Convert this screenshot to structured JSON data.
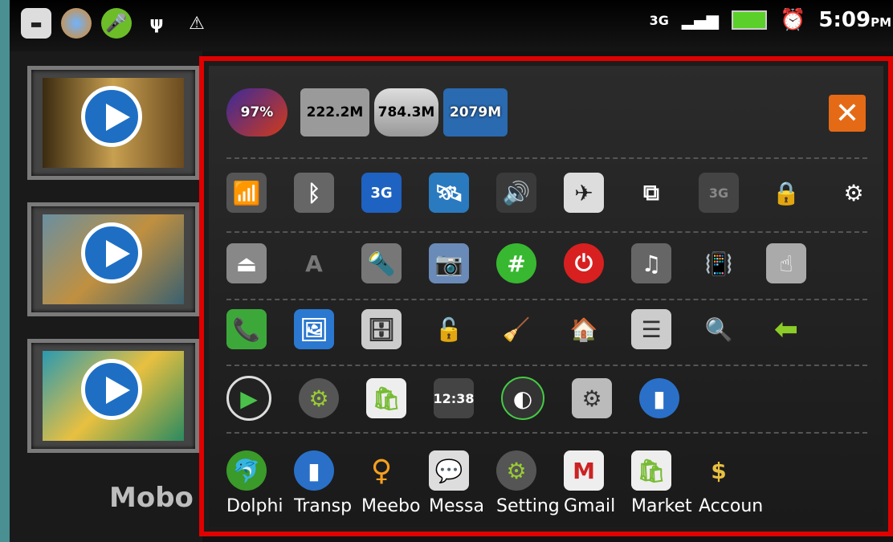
{
  "status_bar": {
    "icons_left": [
      "keyboard-icon",
      "browser-icon",
      "microphone-icon",
      "usb-icon",
      "warning-icon"
    ],
    "network": "3G",
    "time": "5:09",
    "ampm": "PM"
  },
  "left_pane": {
    "thumbnails": 3,
    "app_title": "Mobo"
  },
  "panel": {
    "info": {
      "battery": "97%",
      "memory": "222.2M",
      "storage": "784.3M",
      "sdcard": "2079M"
    },
    "labels": [
      "Dolphi",
      "Transp",
      "Meebo",
      "Messa",
      "Setting",
      "Gmail",
      "Market",
      "Accoun"
    ]
  },
  "colors": {
    "highlight_border": "#e10000",
    "close_button": "#e56a16"
  }
}
